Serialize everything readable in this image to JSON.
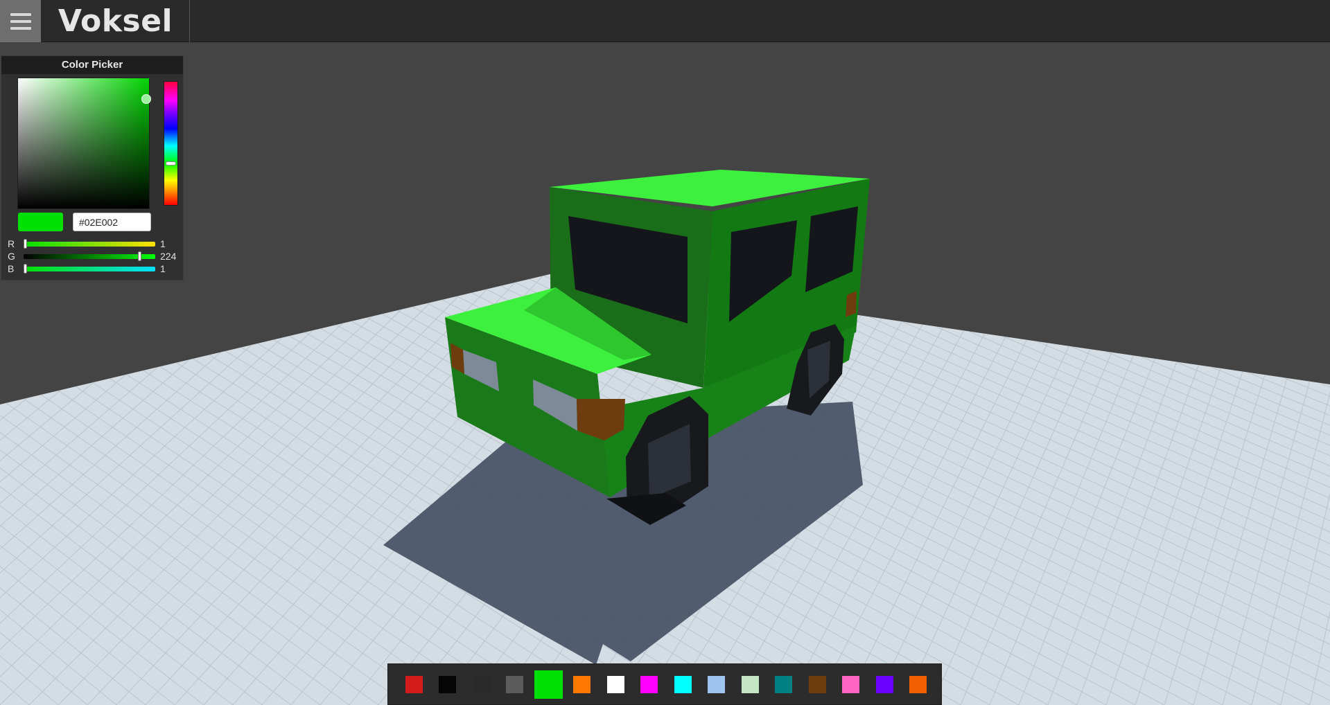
{
  "header": {
    "title": "Voksel",
    "menu_icon": "hamburger-menu-icon"
  },
  "color_picker": {
    "title": "Color Picker",
    "hex_value": "#02E002",
    "current_color": "#02e002",
    "r": {
      "label": "R",
      "value": "1"
    },
    "g": {
      "label": "G",
      "value": "224"
    },
    "b": {
      "label": "B",
      "value": "1"
    }
  },
  "palette": {
    "selected_index": 4,
    "colors": [
      "#d41c1c",
      "#050505",
      "#2a2a2a",
      "#5c5c5c",
      "#02e002",
      "#ff7800",
      "#ffffff",
      "#ff00ff",
      "#00ffff",
      "#a0c4f0",
      "#c4e6c4",
      "#008080",
      "#6e3c0f",
      "#ff66c2",
      "#6a00ff",
      "#f06000"
    ]
  },
  "scene": {
    "background_color": "#444444",
    "floor_color": "#d4dde3",
    "model_color": "#02e002"
  }
}
